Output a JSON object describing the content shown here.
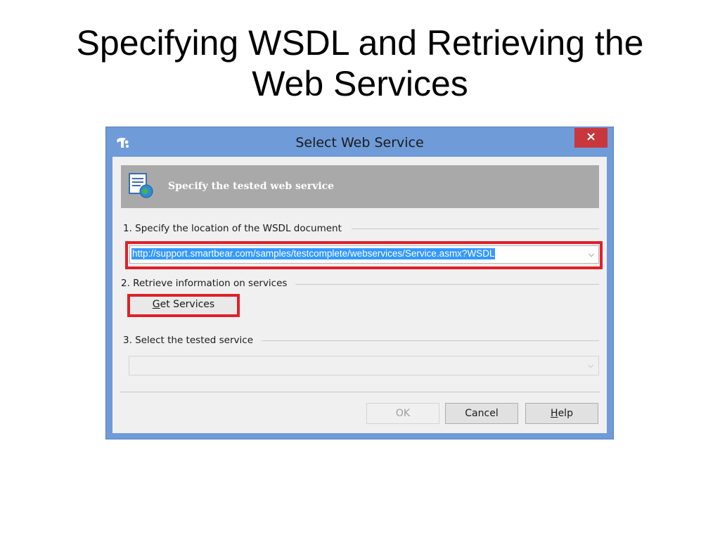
{
  "slide": {
    "title_line1": "Specifying WSDL and Retrieving the",
    "title_line2": "Web Services"
  },
  "dialog": {
    "title": "Select Web Service",
    "close_label": "×",
    "app_icon": "testcomplete-logo-icon",
    "banner": {
      "icon": "web-service-document-icon",
      "text": "Specify the tested web service"
    },
    "step1": {
      "label": "1. Specify the location of the WSDL document",
      "wsdl_value": "http://support.smartbear.com/samples/testcomplete/webservices/Service.asmx?WSDL"
    },
    "step2": {
      "label": "2. Retrieve information on services",
      "get_services_accel": "G",
      "get_services_rest": "et Services"
    },
    "step3": {
      "label": "3. Select the tested service",
      "selected_service": ""
    },
    "buttons": {
      "ok": "OK",
      "cancel": "Cancel",
      "help_accel": "H",
      "help_rest": "elp"
    },
    "colors": {
      "frame": "#6f9bd9",
      "close": "#c7373c",
      "highlight": "#e0202a",
      "selection": "#3399ff",
      "banner": "#a9a9a9"
    }
  }
}
